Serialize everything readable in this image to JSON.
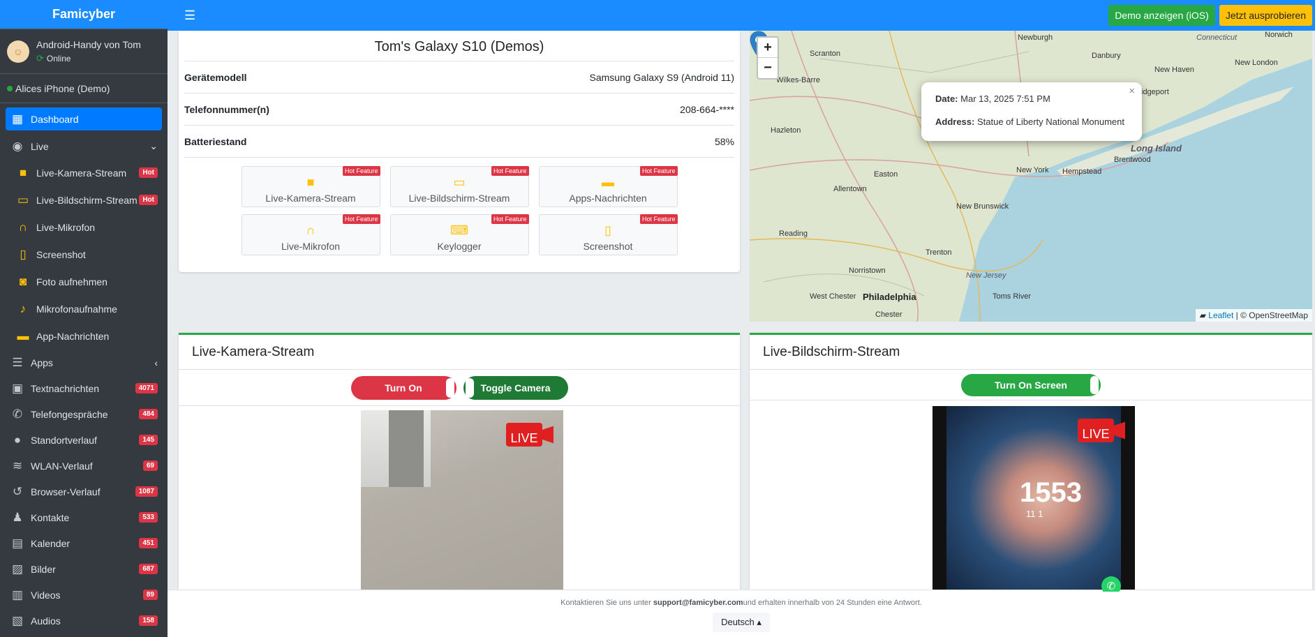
{
  "brand": "Famicyber",
  "device": {
    "name": "Android-Handy von Tom",
    "status": "Online"
  },
  "alt_device": "Alices iPhone (Demo)",
  "nav": {
    "dashboard": "Dashboard",
    "live": "Live",
    "live_items": [
      {
        "label": "Live-Kamera-Stream",
        "badge": "Hot",
        "icon": "camera-icon"
      },
      {
        "label": "Live-Bildschirm-Stream",
        "badge": "Hot",
        "icon": "monitor-icon"
      },
      {
        "label": "Live-Mikrofon",
        "icon": "headphones-icon"
      },
      {
        "label": "Screenshot",
        "icon": "mobile-icon"
      },
      {
        "label": "Foto aufnehmen",
        "icon": "camera-retro-icon"
      },
      {
        "label": "Mikrofonaufnahme",
        "icon": "microphone-icon"
      },
      {
        "label": "App-Nachrichten",
        "icon": "comment-icon"
      }
    ],
    "apps": "Apps",
    "items": [
      {
        "label": "Textnachrichten",
        "badge": "4071",
        "icon": "comments-icon"
      },
      {
        "label": "Telefongespräche",
        "badge": "484",
        "icon": "phone-icon"
      },
      {
        "label": "Standortverlauf",
        "badge": "145",
        "icon": "map-marker-icon"
      },
      {
        "label": "WLAN-Verlauf",
        "badge": "69",
        "icon": "wifi-icon"
      },
      {
        "label": "Browser-Verlauf",
        "badge": "1087",
        "icon": "history-icon"
      },
      {
        "label": "Kontakte",
        "badge": "533",
        "icon": "person-icon"
      },
      {
        "label": "Kalender",
        "badge": "451",
        "icon": "calendar-icon"
      },
      {
        "label": "Bilder",
        "badge": "687",
        "icon": "image-icon"
      },
      {
        "label": "Videos",
        "badge": "89",
        "icon": "film-icon"
      },
      {
        "label": "Audios",
        "badge": "158",
        "icon": "file-audio-icon"
      }
    ]
  },
  "topbar": {
    "demo_ios": "Demo anzeigen (iOS)",
    "try_now": "Jetzt ausprobieren"
  },
  "info": {
    "title": "Tom's Galaxy S10 (Demos)",
    "rows": [
      {
        "key": "Gerätemodell",
        "value": "Samsung Galaxy S9 (Android 11)"
      },
      {
        "key": "Telefonnummer(n)",
        "value": "208-664-****"
      },
      {
        "key": "Batteriestand",
        "value": "58%"
      }
    ],
    "hot_label": "Hot Feature",
    "features": [
      {
        "label": "Live-Kamera-Stream",
        "icon": "camera-icon"
      },
      {
        "label": "Live-Bildschirm-Stream",
        "icon": "monitor-icon"
      },
      {
        "label": "Apps-Nachrichten",
        "icon": "comment-icon"
      },
      {
        "label": "Live-Mikrofon",
        "icon": "headphones-icon"
      },
      {
        "label": "Keylogger",
        "icon": "keyboard-icon"
      },
      {
        "label": "Screenshot",
        "icon": "mobile-icon"
      }
    ]
  },
  "map": {
    "popup_date_label": "Date:",
    "popup_date": "Mar 13, 2025 7:51 PM",
    "popup_address_label": "Address:",
    "popup_address": "Statue of Liberty National Monument",
    "attribution_link": "Leaflet",
    "attribution_rest": "| © OpenStreetMap",
    "places": [
      "Newburgh",
      "Danbury",
      "Scranton",
      "Wilkes-Barre",
      "Hazleton",
      "New Haven",
      "New London",
      "Bridgeport",
      "Long Island",
      "Brentwood",
      "Hempstead",
      "New York",
      "Easton",
      "Allentown",
      "New Brunswick",
      "Reading",
      "Trenton",
      "New Jersey",
      "Norristown",
      "West Chester",
      "Philadelphia",
      "Chester",
      "Toms River",
      "Connecticut",
      "Norwich"
    ]
  },
  "camera_panel": {
    "title": "Live-Kamera-Stream",
    "turn_on": "Turn On",
    "toggle": "Toggle Camera"
  },
  "screen_panel": {
    "title": "Live-Bildschirm-Stream",
    "turn_on": "Turn On Screen",
    "clock": "1553",
    "clock_sub": "11 1"
  },
  "live_text": "LIVE",
  "footer": {
    "pre": "Kontaktieren Sie uns unter ",
    "email": "support@famicyber.com",
    "post": "und erhalten innerhalb von 24 Stunden eine Antwort.",
    "language": "Deutsch ▴"
  }
}
